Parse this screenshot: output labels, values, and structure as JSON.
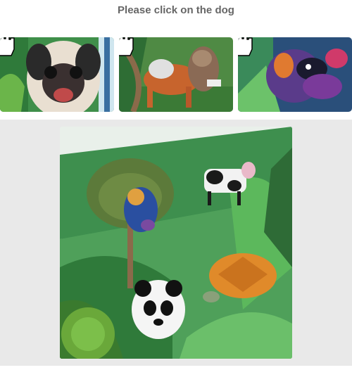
{
  "prompt": {
    "text": "Please click on the dog"
  },
  "options": [
    {
      "subject": "pug"
    },
    {
      "subject": "fox-dog"
    },
    {
      "subject": "colorful-dog"
    }
  ],
  "cursor_icon": "pointer-hand-icon",
  "main_image": {
    "subjects": [
      "dog",
      "cow",
      "panda",
      "turtle",
      "trees",
      "leaves"
    ]
  },
  "footer": {
    "left_text": "",
    "right_text": ""
  },
  "colors": {
    "title": "#666666",
    "stage_bg": "#e9e9e9"
  }
}
